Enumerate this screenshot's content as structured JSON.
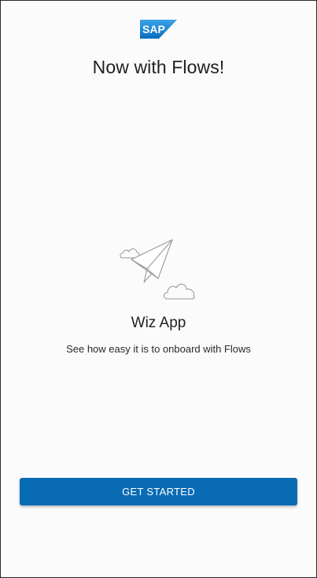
{
  "branding": {
    "logo_text": "SAP",
    "logo_icon": "sap-logo",
    "logo_color": "#1a7fcf"
  },
  "onboarding": {
    "title": "Now with Flows!",
    "illustration_icon": "paper-plane-with-clouds",
    "app_name": "Wiz App",
    "description": "See how easy it is to onboard with Flows",
    "primary_button_label": "GET STARTED"
  },
  "colors": {
    "primary_button": "#0a6bb5",
    "background": "#fbfbfb",
    "text": "#1f1f1f",
    "illustration_stroke": "#9a9a9a"
  }
}
